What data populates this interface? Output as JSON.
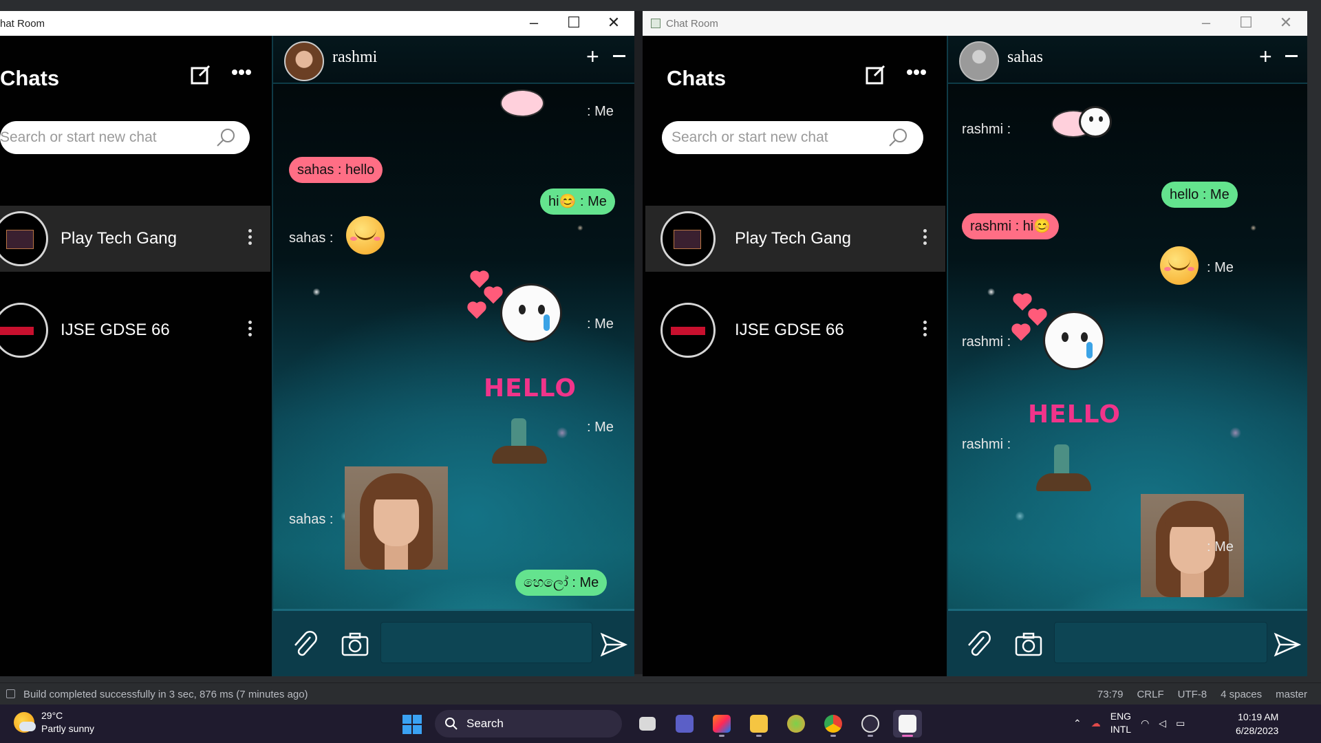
{
  "status_bar": {
    "build_message": "Build completed successfully in 3 sec, 876 ms (7 minutes ago)",
    "position": "73:79",
    "line_sep": "CRLF",
    "encoding": "UTF-8",
    "indent": "4 spaces",
    "branch": "master"
  },
  "taskbar": {
    "weather_temp": "29°C",
    "weather_desc": "Partly sunny",
    "search_label": "Search",
    "lang_line1": "ENG",
    "lang_line2": "INTL",
    "time": "10:19 AM",
    "date": "6/28/2023",
    "apps": [
      "task-view-icon",
      "meet-icon",
      "intellij-icon",
      "file-explorer-icon",
      "scene-builder-icon",
      "chrome-icon",
      "media-player-icon",
      "java-app-icon"
    ]
  },
  "windows": [
    {
      "title": "hat Room",
      "list_title": "Chats",
      "search_placeholder": "Search or start new chat",
      "chats": [
        {
          "name": "Play Tech Gang",
          "selected": true
        },
        {
          "name": "IJSE GDSE 66",
          "selected": false
        }
      ],
      "conversation_name": "rashmi",
      "messages": {
        "m1_label": ": Me",
        "m2_text": "sahas : hello",
        "m3_text": "hi😊 : Me",
        "m4_label": "sahas :",
        "m5_label": ": Me",
        "m6_label": ": Me",
        "m6_sticker_text": "HELLO",
        "m7_label": "sahas :",
        "m8_text": "හෙලෝ : Me"
      }
    },
    {
      "title": "Chat Room",
      "list_title": "Chats",
      "search_placeholder": "Search or start new chat",
      "chats": [
        {
          "name": "Play Tech Gang",
          "selected": true
        },
        {
          "name": "IJSE GDSE 66",
          "selected": false
        }
      ],
      "conversation_name": "sahas",
      "messages": {
        "m1_label": "rashmi :",
        "m2_text": "hello : Me",
        "m3_text": "rashmi : hi😊",
        "m4_label": ": Me",
        "m5_label": "rashmi :",
        "m6_label": "rashmi :",
        "m6_sticker_text": "HELLO",
        "m7_label": ": Me"
      }
    }
  ],
  "colors": {
    "incoming_bubble": "#ff6e85",
    "outgoing_bubble": "#64e38e",
    "composer": "#0c3c4a"
  }
}
